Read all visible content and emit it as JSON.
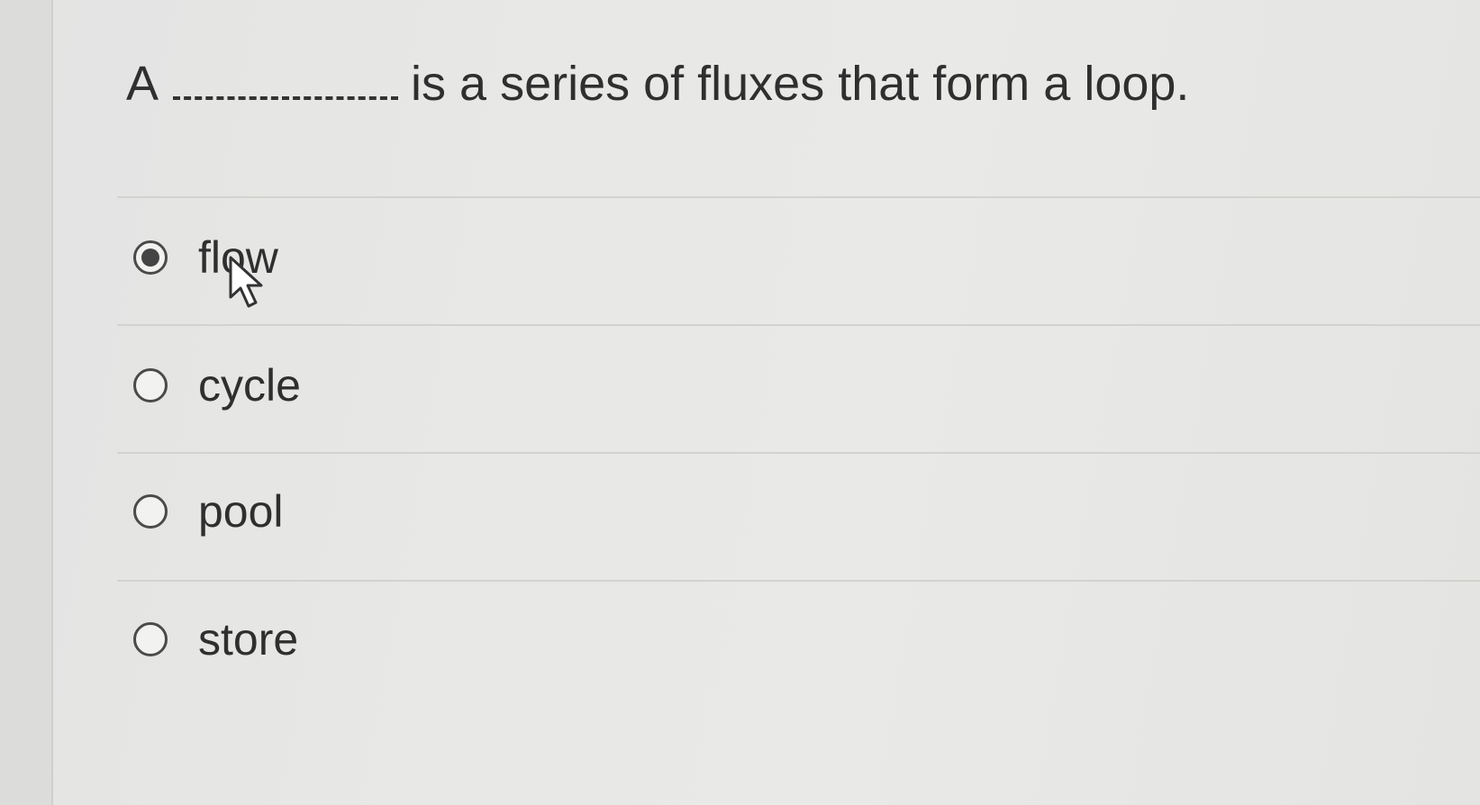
{
  "question": {
    "prefix": "A",
    "suffix": "is a series of fluxes that form a loop."
  },
  "options": [
    {
      "label": "flow",
      "selected": true
    },
    {
      "label": "cycle",
      "selected": false
    },
    {
      "label": "pool",
      "selected": false
    },
    {
      "label": "store",
      "selected": false
    }
  ]
}
